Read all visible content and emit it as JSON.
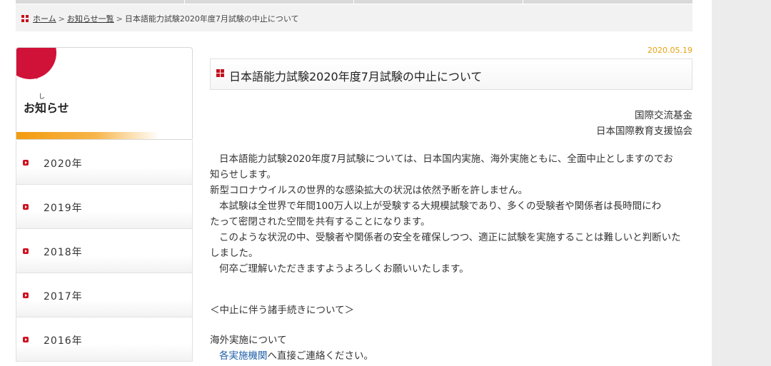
{
  "breadcrumb": {
    "home": "ホーム",
    "sep1": ">",
    "list": "お知らせ一覧",
    "sep2": ">",
    "current": "日本語能力試験2020年度7月試験の中止について"
  },
  "sidebar": {
    "ruby": "し",
    "title": "お知らせ",
    "years": [
      "2020年",
      "2019年",
      "2018年",
      "2017年",
      "2016年"
    ]
  },
  "article": {
    "date": "2020.05.19",
    "title": "日本語能力試験2020年度7月試験の中止について",
    "org1": "国際交流基金",
    "org2": "日本国際教育支援協会",
    "para1_line1": "日本語能力試験2020年度7月試験については、日本国内実施、海外実施ともに、全面中止としますのでお",
    "para1_line2": "知らせします。",
    "para2": "新型コロナウイルスの世界的な感染拡大の状況は依然予断を許しません。",
    "para3_line1": "本試験は全世界で年間100万人以上が受験する大規模試験であり、多くの受験者や関係者は長時間にわ",
    "para3_line2": "たって密閉された空間を共有することになります。",
    "para4_line1": "このような状況の中、受験者や関係者の安全を確保しつつ、適正に試験を実施することは難しいと判断いた",
    "para4_line2": "しました。",
    "para5": "何卒ご理解いただきますようよろしくお願いいたします。",
    "section_heading": "＜中止に伴う諸手続きについて＞",
    "overseas_label": "海外実施について",
    "overseas_link": "各実施機関",
    "overseas_rest": "へ直接ご連絡ください。"
  },
  "colors": {
    "accent_red": "#c5101e",
    "date_orange": "#e8a010",
    "link_blue": "#1f5fa8"
  }
}
